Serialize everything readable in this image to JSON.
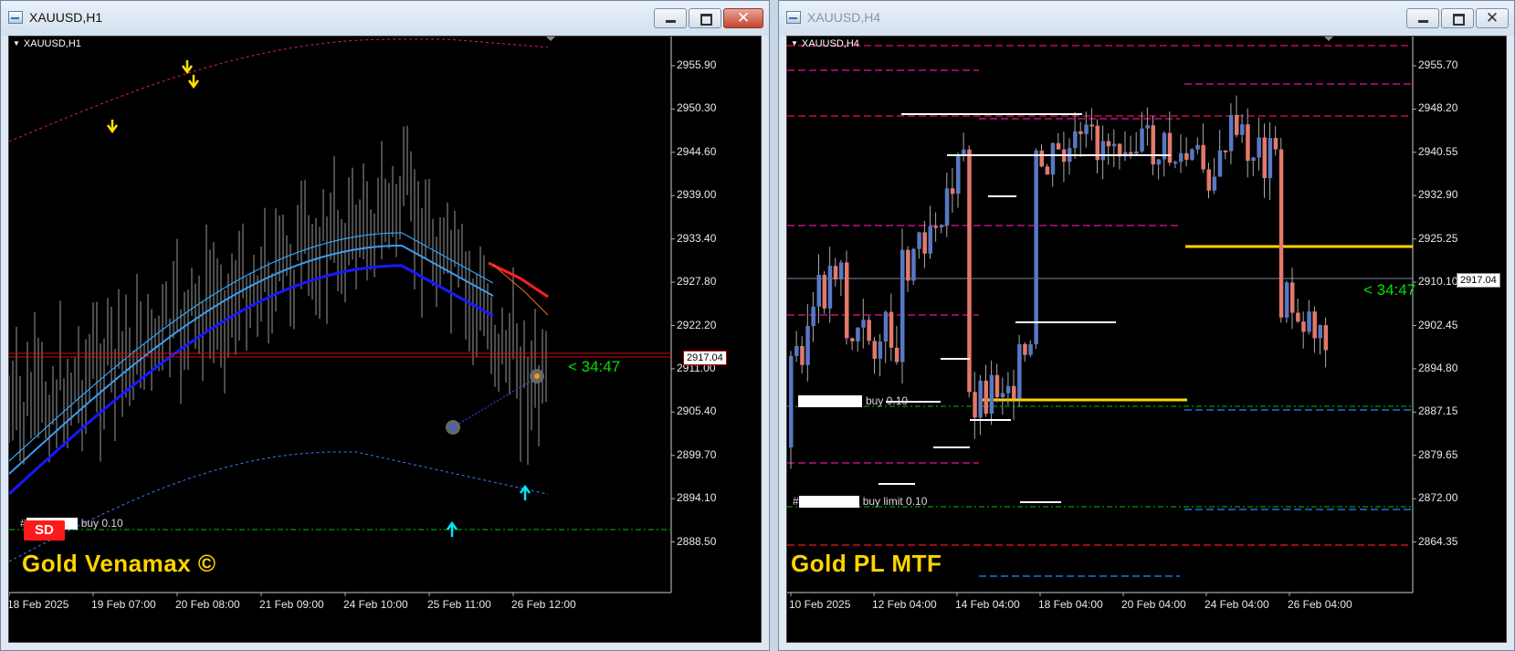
{
  "colors": {
    "bull_candle": "#5877c4",
    "bear_candle": "#e2796a",
    "green_level": "#00c000",
    "yellow_level": "#ffd400",
    "countdown": "#00e000"
  },
  "left_window": {
    "title": "XAUUSD,H1",
    "symbol_label": "XAUUSD,H1",
    "price_ticks": [
      "2955.90",
      "2950.30",
      "2944.60",
      "2939.00",
      "2933.40",
      "2927.80",
      "2922.20",
      "2911.00",
      "2905.40",
      "2899.70",
      "2894.10",
      "2888.50"
    ],
    "current_price": "2917.04",
    "countdown": "< 34:47",
    "time_ticks": [
      "18 Feb 2025",
      "19 Feb 07:00",
      "20 Feb 08:00",
      "21 Feb 09:00",
      "24 Feb 10:00",
      "25 Feb 11:00",
      "26 Feb 12:00"
    ],
    "order_label": "buy 0.10",
    "order_prefix": "#",
    "sd_badge": "SD",
    "branding": "Gold Venamax ©",
    "icons": {
      "minimize": "minimize-icon",
      "maximize": "maximize-icon",
      "close": "close-icon"
    }
  },
  "right_window": {
    "title": "XAUUSD,H4",
    "symbol_label": "XAUUSD,H4",
    "price_ticks": [
      "2955.70",
      "2948.20",
      "2940.55",
      "2932.90",
      "2925.25",
      "2910.10",
      "2902.45",
      "2894.80",
      "2887.15",
      "2879.65",
      "2872.00",
      "2864.35"
    ],
    "current_price": "2917.04",
    "countdown": "< 34:47",
    "time_ticks": [
      "10 Feb 2025",
      "12 Feb 04:00",
      "14 Feb 04:00",
      "18 Feb 04:00",
      "20 Feb 04:00",
      "24 Feb 04:00",
      "26 Feb 04:00"
    ],
    "order_label_1": "buy 0.10",
    "order_label_2": "buy limit 0.10",
    "order_prefix": "#",
    "branding": "Gold PL MTF"
  },
  "chart_data": [
    {
      "type": "candlestick",
      "title": "XAUUSD,H1",
      "ylim": [
        2886,
        2961
      ],
      "current_price": 2917.04,
      "ma_series": [
        "fast",
        "middle",
        "slow"
      ]
    },
    {
      "type": "candlestick",
      "title": "XAUUSD,H4",
      "ylim": [
        2861,
        2962
      ],
      "current_price": 2917.04
    }
  ]
}
